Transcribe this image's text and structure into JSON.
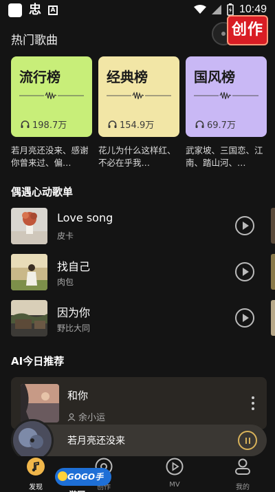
{
  "status_bar": {
    "time": "10:49"
  },
  "create_button": {
    "label": "创作"
  },
  "hot_songs": {
    "title": "热门歌曲",
    "charts": [
      {
        "title": "流行榜",
        "plays": "198.7万",
        "color": "#c8ee79",
        "desc": "若月亮还没来、感谢你曾来过、偏…"
      },
      {
        "title": "经典榜",
        "plays": "154.9万",
        "color": "#f2e6a6",
        "desc": "花儿为什么这样红、不必在乎我…"
      },
      {
        "title": "国风榜",
        "plays": "69.7万",
        "color": "#c9b8f5",
        "desc": "武家坡、三国恋、江南、踏山河、…"
      }
    ]
  },
  "playlist": {
    "title": "偶遇心动歌单",
    "songs": [
      {
        "name": "Love song",
        "artist": "皮卡"
      },
      {
        "name": "找自己",
        "artist": "肉包"
      },
      {
        "name": "因为你",
        "artist": "野比大同"
      }
    ]
  },
  "ai_section": {
    "title": "AI今日推荐",
    "song": {
      "name": "和你",
      "artist": "余小运"
    }
  },
  "now_playing": {
    "title": "若月亮还没来"
  },
  "tabs": [
    {
      "label": "发现",
      "icon": "music-note-icon",
      "active": true
    },
    {
      "label": "创作",
      "icon": "disc-icon",
      "active": false
    },
    {
      "label": "MV",
      "icon": "play-circle-icon",
      "active": false
    },
    {
      "label": "我的",
      "icon": "person-icon",
      "active": false
    }
  ],
  "watermark": "GOGO手游网"
}
